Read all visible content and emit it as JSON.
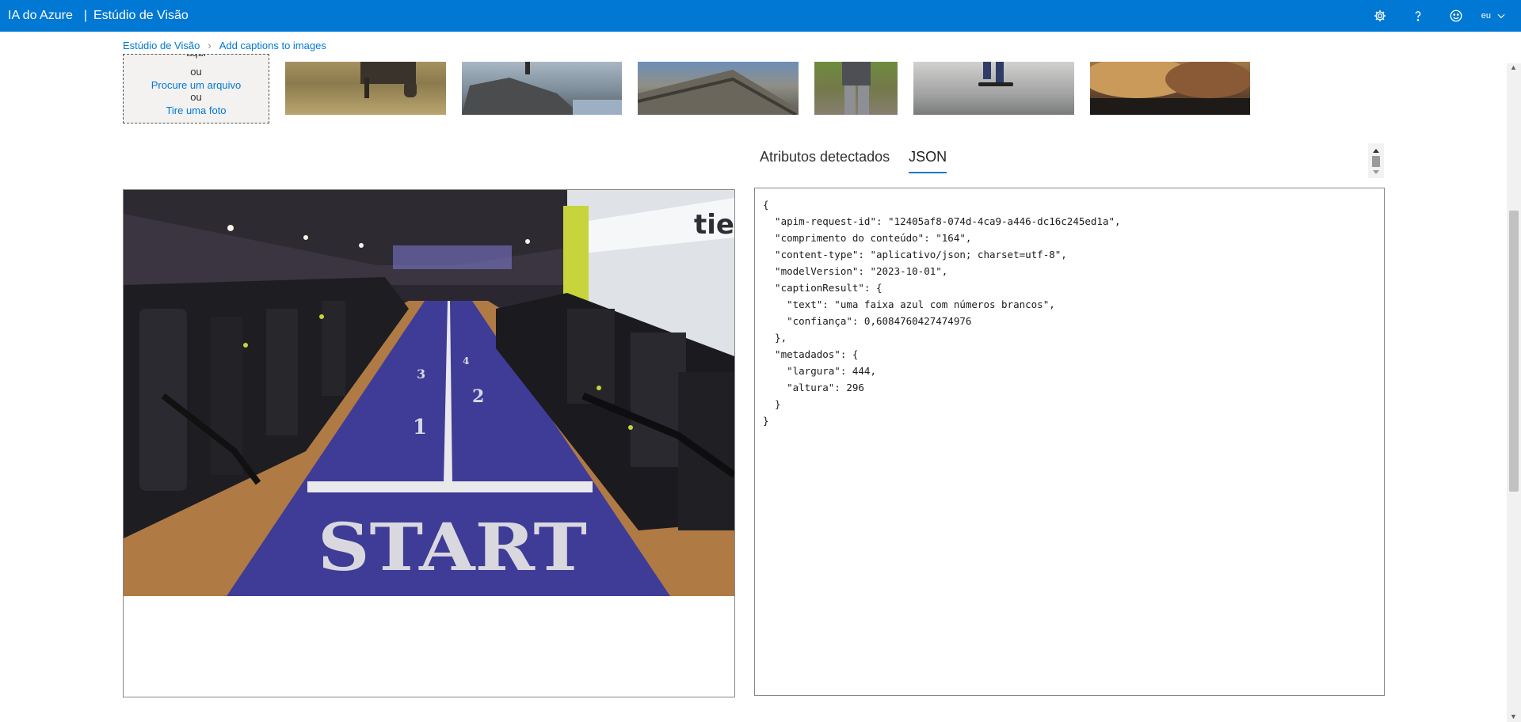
{
  "header": {
    "product": "IA do Azure",
    "separator": "|",
    "studio": "Estúdio de Visão",
    "user_label": "eu",
    "icons": [
      "gear-icon",
      "help-icon",
      "smiley-icon",
      "chevron-down-icon"
    ]
  },
  "breadcrumb": {
    "root": "Estúdio de Visão",
    "current": "Add captions to images"
  },
  "upload": {
    "clipped_line": "aqui",
    "or_1": "ou",
    "browse": "Procure um arquivo",
    "or_2": "ou",
    "photo": "Tire uma foto"
  },
  "main_image": {
    "floor_numbers": [
      "1",
      "2",
      "3",
      "4"
    ],
    "floor_text": "START",
    "sign_text": "tie"
  },
  "tabs": [
    {
      "label": "Atributos detectados",
      "active": false
    },
    {
      "label": "JSON",
      "active": true
    }
  ],
  "json_lines": [
    "{",
    "  \"apim-request-id\": \"12405af8-074d-4ca9-a446-dc16c245ed1a\",",
    "  \"comprimento do conteúdo\": \"164\",",
    "  \"content-type\": \"aplicativo/json; charset=utf-8\",",
    "  \"modelVersion\": \"2023-10-01\",",
    "  \"captionResult\": {",
    "    \"text\": \"uma faixa azul com números brancos\",",
    "    \"confiança\": 0,6084760427474976",
    "  },",
    "  \"metadados\": {",
    "    \"largura\": 444,",
    "    \"altura\": 296",
    "  }",
    "}"
  ],
  "colors": {
    "accent": "#0078d4",
    "border": "#8a8886"
  }
}
